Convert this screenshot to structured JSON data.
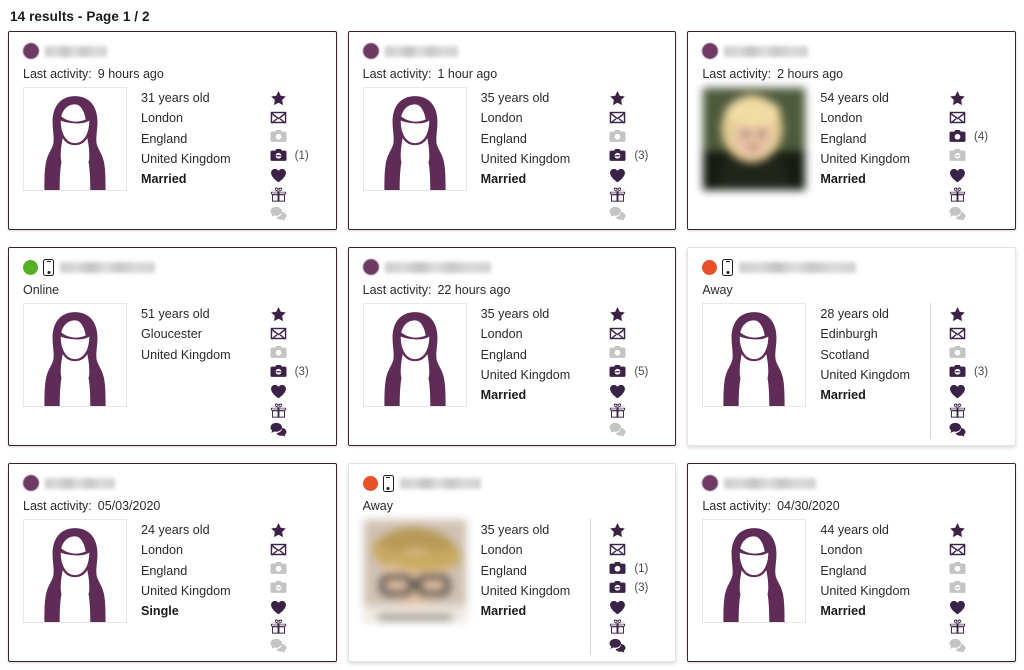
{
  "header": {
    "results_text": "14 results - Page 1 / 2",
    "results_count": 14,
    "page_current": 1,
    "page_total": 2
  },
  "labels": {
    "last_activity": "Last activity:",
    "years_old_suffix": "years old",
    "online": "Online",
    "away": "Away"
  },
  "colors": {
    "accent_purple": "#3b2247",
    "avatar_purple": "#6e3a63",
    "silhouette_purple": "#5f2c58",
    "card_border_dark": "#3b2233",
    "card_border_light": "#e2e2e2",
    "status_online": "#56af23",
    "status_away": "#e8502a",
    "icon_disabled": "#c4c4c4",
    "text": "#2b2b2b"
  },
  "icon_order": [
    "favorite-star-icon",
    "message-envelope-icon",
    "public-photos-camera-icon",
    "private-photos-camera-icon",
    "like-heart-icon",
    "gift-icon",
    "chat-bubble-icon"
  ],
  "cards": [
    {
      "id": "card-1",
      "theme": "dark",
      "name": "redacted-name-1",
      "presence": null,
      "activity_label": "Last activity:",
      "activity_value": "9 hours ago",
      "photo": "silhouette",
      "details": [
        "31 years old",
        "London",
        "England",
        "United Kingdom"
      ],
      "marital": "Married",
      "icons": [
        {
          "name": "favorite-star-icon",
          "state": "on",
          "count": ""
        },
        {
          "name": "message-envelope-icon",
          "state": "on",
          "count": ""
        },
        {
          "name": "public-photos-camera-icon",
          "state": "off",
          "count": ""
        },
        {
          "name": "private-photos-camera-icon",
          "state": "on",
          "count": "(1)"
        },
        {
          "name": "like-heart-icon",
          "state": "on",
          "count": ""
        },
        {
          "name": "gift-icon",
          "state": "on",
          "count": ""
        },
        {
          "name": "chat-bubble-icon",
          "state": "off",
          "count": ""
        }
      ]
    },
    {
      "id": "card-2",
      "theme": "dark",
      "name": "redacted-name-2",
      "presence": null,
      "activity_label": "Last activity:",
      "activity_value": "1 hour ago",
      "photo": "silhouette",
      "details": [
        "35 years old",
        "London",
        "England",
        "United Kingdom"
      ],
      "marital": "Married",
      "icons": [
        {
          "name": "favorite-star-icon",
          "state": "on",
          "count": ""
        },
        {
          "name": "message-envelope-icon",
          "state": "on",
          "count": ""
        },
        {
          "name": "public-photos-camera-icon",
          "state": "off",
          "count": ""
        },
        {
          "name": "private-photos-camera-icon",
          "state": "on",
          "count": "(3)"
        },
        {
          "name": "like-heart-icon",
          "state": "on",
          "count": ""
        },
        {
          "name": "gift-icon",
          "state": "on",
          "count": ""
        },
        {
          "name": "chat-bubble-icon",
          "state": "off",
          "count": ""
        }
      ]
    },
    {
      "id": "card-3",
      "theme": "dark",
      "name": "redacted-name-3",
      "presence": null,
      "activity_label": "Last activity:",
      "activity_value": "2 hours ago",
      "photo": "real",
      "details": [
        "54 years old",
        "London",
        "England",
        "United Kingdom"
      ],
      "marital": "Married",
      "icons": [
        {
          "name": "favorite-star-icon",
          "state": "on",
          "count": ""
        },
        {
          "name": "message-envelope-icon",
          "state": "on",
          "count": ""
        },
        {
          "name": "public-photos-camera-icon",
          "state": "on",
          "count": "(4)"
        },
        {
          "name": "private-photos-camera-icon",
          "state": "off",
          "count": ""
        },
        {
          "name": "like-heart-icon",
          "state": "on",
          "count": ""
        },
        {
          "name": "gift-icon",
          "state": "on",
          "count": ""
        },
        {
          "name": "chat-bubble-icon",
          "state": "off",
          "count": ""
        }
      ]
    },
    {
      "id": "card-4",
      "theme": "dark",
      "name": "redacted-name-4",
      "presence": "online",
      "activity_label": "",
      "activity_value": "Online",
      "photo": "silhouette",
      "details": [
        "51 years old",
        "Gloucester",
        "United Kingdom"
      ],
      "marital": "",
      "icons": [
        {
          "name": "favorite-star-icon",
          "state": "on",
          "count": ""
        },
        {
          "name": "message-envelope-icon",
          "state": "on",
          "count": ""
        },
        {
          "name": "public-photos-camera-icon",
          "state": "off",
          "count": ""
        },
        {
          "name": "private-photos-camera-icon",
          "state": "on",
          "count": "(3)"
        },
        {
          "name": "like-heart-icon",
          "state": "on",
          "count": ""
        },
        {
          "name": "gift-icon",
          "state": "on",
          "count": ""
        },
        {
          "name": "chat-bubble-icon",
          "state": "on",
          "count": ""
        }
      ]
    },
    {
      "id": "card-5",
      "theme": "dark",
      "name": "redacted-name-5",
      "presence": null,
      "activity_label": "Last activity:",
      "activity_value": "22 hours ago",
      "photo": "silhouette",
      "details": [
        "35 years old",
        "London",
        "England",
        "United Kingdom"
      ],
      "marital": "Married",
      "icons": [
        {
          "name": "favorite-star-icon",
          "state": "on",
          "count": ""
        },
        {
          "name": "message-envelope-icon",
          "state": "on",
          "count": ""
        },
        {
          "name": "public-photos-camera-icon",
          "state": "off",
          "count": ""
        },
        {
          "name": "private-photos-camera-icon",
          "state": "on",
          "count": "(5)"
        },
        {
          "name": "like-heart-icon",
          "state": "on",
          "count": ""
        },
        {
          "name": "gift-icon",
          "state": "on",
          "count": ""
        },
        {
          "name": "chat-bubble-icon",
          "state": "off",
          "count": ""
        }
      ]
    },
    {
      "id": "card-6",
      "theme": "light",
      "name": "redacted-name-6",
      "presence": "away",
      "activity_label": "",
      "activity_value": "Away",
      "photo": "silhouette",
      "details": [
        "28 years old",
        "Edinburgh",
        "Scotland",
        "United Kingdom"
      ],
      "marital": "Married",
      "icons": [
        {
          "name": "favorite-star-icon",
          "state": "on",
          "count": ""
        },
        {
          "name": "message-envelope-icon",
          "state": "on",
          "count": ""
        },
        {
          "name": "public-photos-camera-icon",
          "state": "off",
          "count": ""
        },
        {
          "name": "private-photos-camera-icon",
          "state": "on",
          "count": "(3)"
        },
        {
          "name": "like-heart-icon",
          "state": "on",
          "count": ""
        },
        {
          "name": "gift-icon",
          "state": "on",
          "count": ""
        },
        {
          "name": "chat-bubble-icon",
          "state": "on",
          "count": ""
        }
      ]
    },
    {
      "id": "card-7",
      "theme": "dark",
      "name": "redacted-name-7",
      "presence": null,
      "activity_label": "Last activity:",
      "activity_value": "05/03/2020",
      "photo": "silhouette",
      "details": [
        "24 years old",
        "London",
        "England",
        "United Kingdom"
      ],
      "marital": "Single",
      "icons": [
        {
          "name": "favorite-star-icon",
          "state": "on",
          "count": ""
        },
        {
          "name": "message-envelope-icon",
          "state": "on",
          "count": ""
        },
        {
          "name": "public-photos-camera-icon",
          "state": "off",
          "count": ""
        },
        {
          "name": "private-photos-camera-icon",
          "state": "off",
          "count": ""
        },
        {
          "name": "like-heart-icon",
          "state": "on",
          "count": ""
        },
        {
          "name": "gift-icon",
          "state": "on",
          "count": ""
        },
        {
          "name": "chat-bubble-icon",
          "state": "off",
          "count": ""
        }
      ]
    },
    {
      "id": "card-8",
      "theme": "light",
      "name": "redacted-name-8",
      "presence": "away",
      "activity_label": "",
      "activity_value": "Away",
      "photo": "real",
      "details": [
        "35 years old",
        "London",
        "England",
        "United Kingdom"
      ],
      "marital": "Married",
      "icons": [
        {
          "name": "favorite-star-icon",
          "state": "on",
          "count": ""
        },
        {
          "name": "message-envelope-icon",
          "state": "on",
          "count": ""
        },
        {
          "name": "public-photos-camera-icon",
          "state": "on",
          "count": "(1)"
        },
        {
          "name": "private-photos-camera-icon",
          "state": "on",
          "count": "(3)"
        },
        {
          "name": "like-heart-icon",
          "state": "on",
          "count": ""
        },
        {
          "name": "gift-icon",
          "state": "on",
          "count": ""
        },
        {
          "name": "chat-bubble-icon",
          "state": "on",
          "count": ""
        }
      ]
    },
    {
      "id": "card-9",
      "theme": "dark",
      "name": "redacted-name-9",
      "presence": null,
      "activity_label": "Last activity:",
      "activity_value": "04/30/2020",
      "photo": "silhouette",
      "details": [
        "44 years old",
        "London",
        "England",
        "United Kingdom"
      ],
      "marital": "Married",
      "icons": [
        {
          "name": "favorite-star-icon",
          "state": "on",
          "count": ""
        },
        {
          "name": "message-envelope-icon",
          "state": "on",
          "count": ""
        },
        {
          "name": "public-photos-camera-icon",
          "state": "off",
          "count": ""
        },
        {
          "name": "private-photos-camera-icon",
          "state": "off",
          "count": ""
        },
        {
          "name": "like-heart-icon",
          "state": "on",
          "count": ""
        },
        {
          "name": "gift-icon",
          "state": "on",
          "count": ""
        },
        {
          "name": "chat-bubble-icon",
          "state": "off",
          "count": ""
        }
      ]
    }
  ]
}
